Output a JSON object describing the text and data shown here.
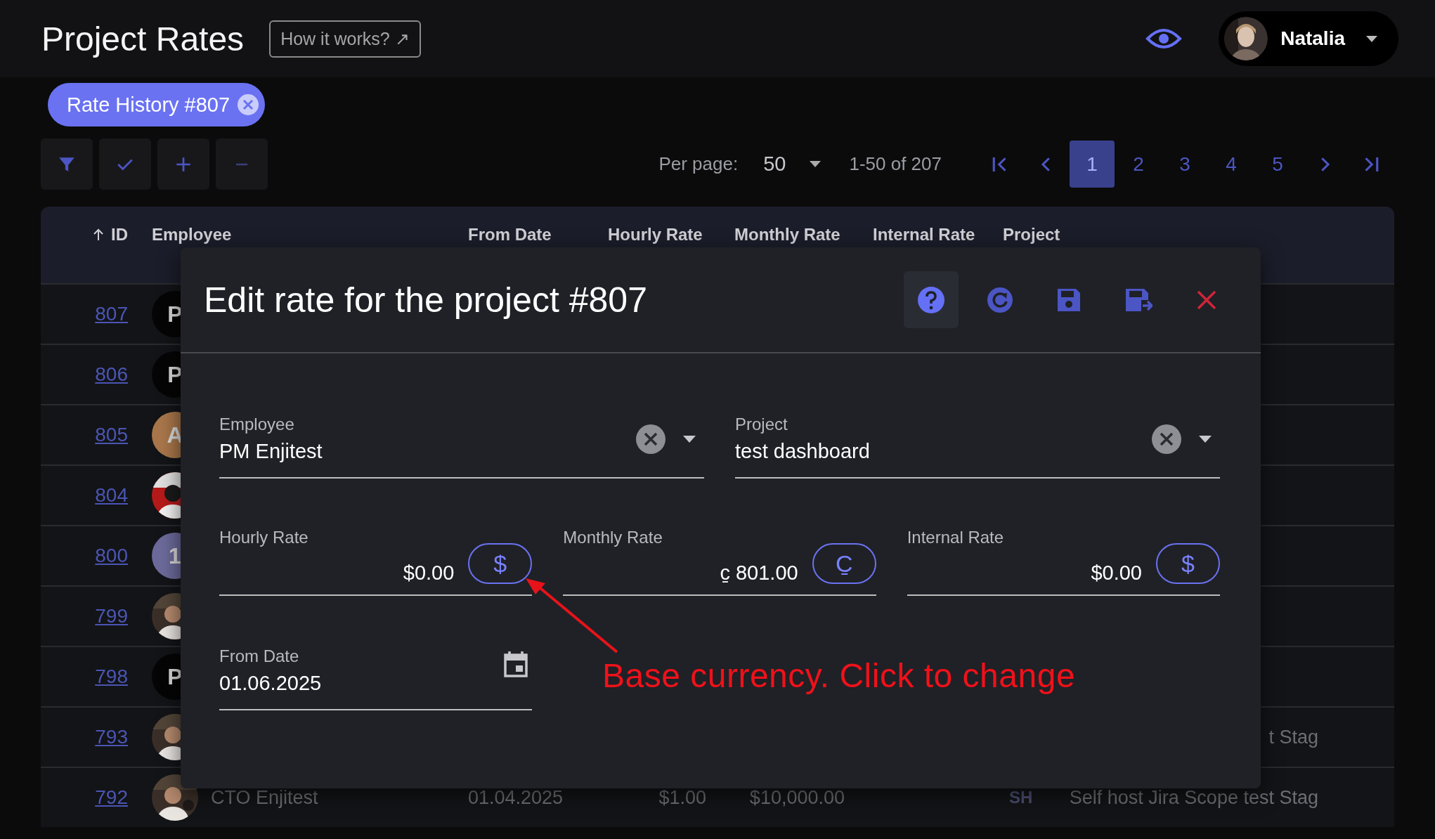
{
  "header": {
    "title": "Project Rates",
    "help_link": "How it works? ↗",
    "user": {
      "name": "Natalia"
    }
  },
  "filter_chips": [
    {
      "label": "Rate History #807"
    }
  ],
  "pagination": {
    "per_page_label": "Per page:",
    "per_page": "50",
    "range": "1-50 of 207",
    "pages": [
      {
        "label": "1",
        "selected": true
      },
      {
        "label": "2",
        "selected": false
      },
      {
        "label": "3",
        "selected": false
      },
      {
        "label": "4",
        "selected": false
      },
      {
        "label": "5",
        "selected": false
      }
    ]
  },
  "table": {
    "columns": [
      {
        "label": "ID",
        "sorted": true
      },
      {
        "label": "Employee"
      },
      {
        "label": "From Date"
      },
      {
        "label": "Hourly Rate"
      },
      {
        "label": "Monthly Rate"
      },
      {
        "label": "Internal Rate"
      },
      {
        "label": "Project"
      }
    ],
    "rows": [
      {
        "id": "807",
        "avatar": {
          "kind": "initials",
          "text": "P",
          "color": "#050505"
        }
      },
      {
        "id": "806",
        "avatar": {
          "kind": "initials",
          "text": "P",
          "color": "#050505"
        }
      },
      {
        "id": "805",
        "avatar": {
          "kind": "initials",
          "text": "A",
          "color": "#a8764a"
        }
      },
      {
        "id": "804"
      },
      {
        "id": "800",
        "avatar": {
          "kind": "initials",
          "text": "1",
          "color": "#6b6a9a"
        }
      },
      {
        "id": "799"
      },
      {
        "id": "798",
        "avatar": {
          "kind": "initials",
          "text": "P",
          "color": "#050505"
        }
      },
      {
        "id": "793",
        "project": "t Stag"
      },
      {
        "id": "792",
        "employee": "CTO Enjitest",
        "from_date": "01.04.2025",
        "hourly_rate": "$1.00",
        "monthly_rate": "$10,000.00",
        "project_badge": "SH",
        "project": "Self host Jira Scope test Stag"
      }
    ]
  },
  "dialog": {
    "title": "Edit rate for the project #807",
    "field_rows": [
      [
        {
          "kind": "select",
          "label": "Employee",
          "value": "PM Enjitest"
        },
        {
          "kind": "select",
          "label": "Project",
          "value": "test dashboard"
        }
      ],
      [
        {
          "kind": "money",
          "label": "Hourly Rate",
          "value": "$0.00",
          "currency": "$"
        },
        {
          "kind": "money",
          "label": "Monthly Rate",
          "value": "c̱ 801.00",
          "currency": "C̱"
        },
        {
          "kind": "money",
          "label": "Internal Rate",
          "value": "$0.00",
          "currency": "$"
        }
      ],
      [
        {
          "kind": "date",
          "label": "From Date",
          "value": "01.06.2025"
        }
      ]
    ],
    "annotation": "Base currency. Click to change"
  }
}
